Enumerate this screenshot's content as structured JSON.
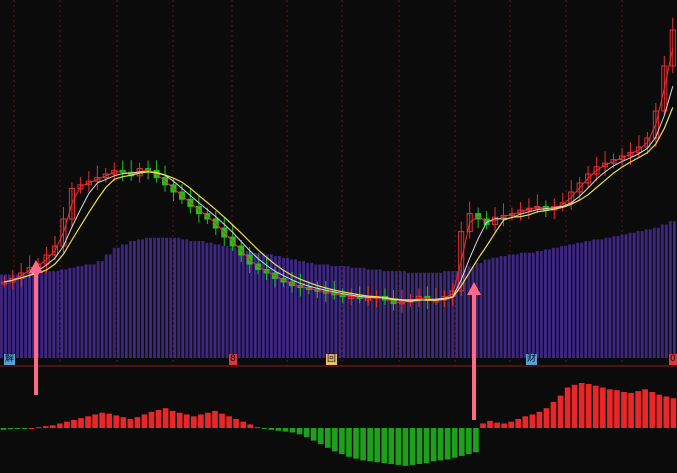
{
  "chart_data": [
    {
      "type": "candlestick",
      "panel": "price",
      "title": "",
      "xlabel": "",
      "ylabel": "",
      "series": [
        {
          "kind": "close",
          "values": [
            0.2,
            0.22,
            0.25,
            0.28,
            0.3,
            0.35,
            0.4,
            0.55,
            0.72,
            0.74,
            0.76,
            0.78,
            0.8,
            0.82,
            0.81,
            0.79,
            0.83,
            0.82,
            0.78,
            0.74,
            0.7,
            0.66,
            0.62,
            0.58,
            0.55,
            0.5,
            0.45,
            0.4,
            0.35,
            0.3,
            0.27,
            0.25,
            0.22,
            0.2,
            0.18,
            0.17,
            0.16,
            0.15,
            0.14,
            0.13,
            0.12,
            0.12,
            0.11,
            0.11,
            0.12,
            0.1,
            0.08,
            0.09,
            0.1,
            0.12,
            0.1,
            0.1,
            0.12,
            0.15,
            0.48,
            0.58,
            0.55,
            0.52,
            0.56,
            0.57,
            0.58,
            0.6,
            0.61,
            0.62,
            0.6,
            0.62,
            0.64,
            0.7,
            0.75,
            0.8,
            0.84,
            0.86,
            0.88,
            0.9,
            0.92,
            0.95,
            1.0,
            1.15,
            1.4,
            1.6
          ]
        },
        {
          "kind": "ma-red",
          "color": "#e83030"
        },
        {
          "kind": "ma-yellow",
          "color": "#e8e050"
        },
        {
          "kind": "ma-white",
          "color": "#d8d8d8"
        }
      ]
    },
    {
      "type": "area",
      "panel": "price-background",
      "series": [
        {
          "kind": "bands",
          "color": "#3a2a8a",
          "values": [
            0.5,
            0.5,
            0.5,
            0.51,
            0.51,
            0.52,
            0.52,
            0.53,
            0.54,
            0.55,
            0.56,
            0.58,
            0.62,
            0.66,
            0.68,
            0.7,
            0.71,
            0.72,
            0.72,
            0.72,
            0.72,
            0.71,
            0.7,
            0.7,
            0.69,
            0.68,
            0.67,
            0.66,
            0.65,
            0.64,
            0.63,
            0.62,
            0.61,
            0.6,
            0.59,
            0.58,
            0.57,
            0.56,
            0.56,
            0.55,
            0.55,
            0.54,
            0.54,
            0.53,
            0.53,
            0.52,
            0.52,
            0.52,
            0.51,
            0.51,
            0.51,
            0.51,
            0.52,
            0.52,
            0.53,
            0.55,
            0.57,
            0.59,
            0.6,
            0.61,
            0.62,
            0.63,
            0.63,
            0.64,
            0.65,
            0.66,
            0.67,
            0.68,
            0.69,
            0.7,
            0.71,
            0.72,
            0.73,
            0.74,
            0.75,
            0.76,
            0.77,
            0.78,
            0.8,
            0.82
          ]
        }
      ]
    },
    {
      "type": "bar",
      "panel": "oscillator",
      "series": [
        {
          "kind": "oscillator",
          "color_up": "#e82828",
          "color_down": "#1ea01e",
          "values": [
            -0.04,
            -0.03,
            -0.02,
            -0.01,
            0.0,
            0.02,
            0.04,
            0.06,
            0.1,
            0.14,
            0.18,
            0.22,
            0.26,
            0.3,
            0.34,
            0.32,
            0.28,
            0.24,
            0.2,
            0.24,
            0.3,
            0.36,
            0.4,
            0.44,
            0.38,
            0.34,
            0.3,
            0.26,
            0.3,
            0.34,
            0.38,
            0.32,
            0.26,
            0.2,
            0.14,
            0.08,
            0.02,
            -0.02,
            -0.04,
            -0.06,
            -0.08,
            -0.1,
            -0.14,
            -0.2,
            -0.28,
            -0.36,
            -0.44,
            -0.52,
            -0.58,
            -0.64,
            -0.68,
            -0.72,
            -0.74,
            -0.76,
            -0.78,
            -0.8,
            -0.82,
            -0.84,
            -0.82,
            -0.8,
            -0.78,
            -0.74,
            -0.72,
            -0.7,
            -0.66,
            -0.62,
            -0.58,
            -0.54,
            0.1,
            0.16,
            0.12,
            0.1,
            0.14,
            0.2,
            0.26,
            0.3,
            0.36,
            0.44,
            0.58,
            0.72,
            0.9,
            0.96,
            1.0,
            0.98,
            0.94,
            0.9,
            0.86,
            0.84,
            0.8,
            0.78,
            0.82,
            0.86,
            0.8,
            0.74,
            0.7,
            0.66
          ]
        }
      ]
    }
  ],
  "markers": [
    {
      "text": "解",
      "color": "#5aa0d8"
    },
    {
      "text": "8",
      "color": "#d83a3a"
    },
    {
      "text": "回",
      "color": "#e8c070"
    },
    {
      "text": "财",
      "color": "#5aa0d8"
    },
    {
      "text": "0",
      "color": "#d83a3a"
    }
  ],
  "colors": {
    "background": "#0b0b0b",
    "grid": "#5a1a1a",
    "arrow": "#ff6a8a",
    "separator": "#8a1a1a"
  }
}
